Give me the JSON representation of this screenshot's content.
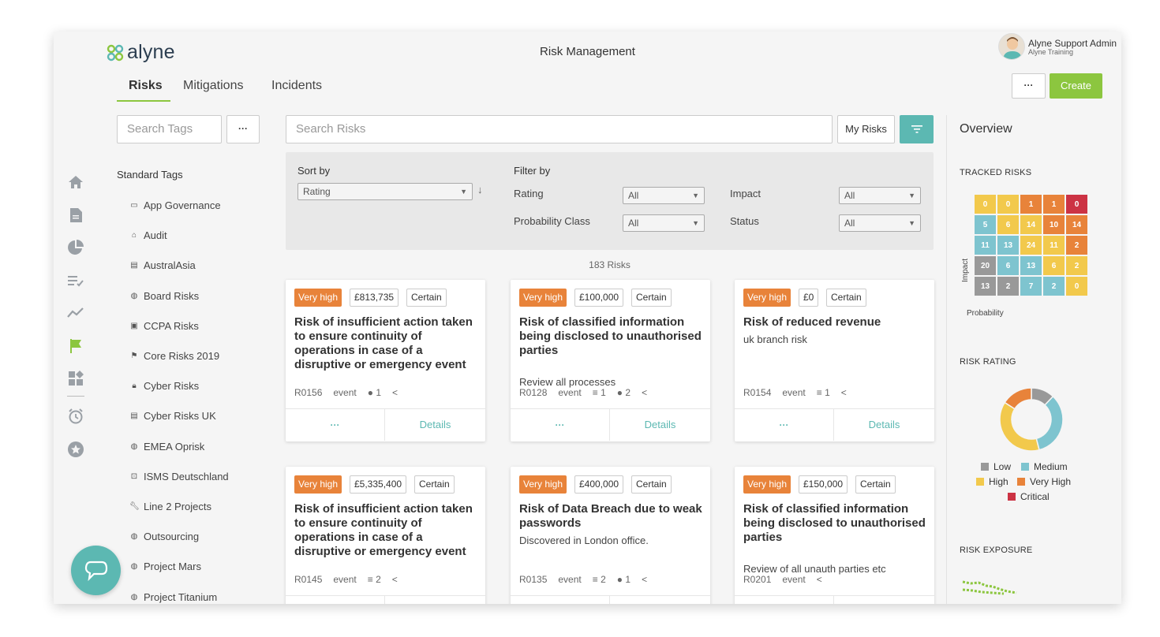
{
  "app": {
    "logo_text": "alyne",
    "page_title": "Risk Management"
  },
  "nav": {
    "tabs": [
      {
        "label": "Risks"
      },
      {
        "label": "Mitigations"
      },
      {
        "label": "Incidents"
      }
    ]
  },
  "user": {
    "name": "Alyne Support Admin",
    "org": "Alyne Training"
  },
  "toolbar": {
    "more_label": "···",
    "create_label": "Create",
    "my_risks_label": "My Risks"
  },
  "search": {
    "tags_placeholder": "Search Tags",
    "risks_placeholder": "Search Risks",
    "tags_more_label": "···"
  },
  "tags": {
    "heading": "Standard Tags",
    "items": [
      {
        "label": "App Governance",
        "icon": "laptop-icon"
      },
      {
        "label": "Audit",
        "icon": "bank-icon"
      },
      {
        "label": "AustralAsia",
        "icon": "clipboard-icon"
      },
      {
        "label": "Board Risks",
        "icon": "globe-icon"
      },
      {
        "label": "CCPA Risks",
        "icon": "id-card-icon"
      },
      {
        "label": "Core Risks 2019",
        "icon": "flag-icon"
      },
      {
        "label": "Cyber Risks",
        "icon": "lock-icon"
      },
      {
        "label": "Cyber Risks UK",
        "icon": "clipboard-icon"
      },
      {
        "label": "EMEA Oprisk",
        "icon": "globe-icon"
      },
      {
        "label": "ISMS Deutschland",
        "icon": "stamp-icon"
      },
      {
        "label": "Line 2 Projects",
        "icon": "wrench-icon"
      },
      {
        "label": "Outsourcing",
        "icon": "globe-icon"
      },
      {
        "label": "Project Mars",
        "icon": "globe-icon"
      },
      {
        "label": "Project Titanium",
        "icon": "globe-icon"
      }
    ]
  },
  "sort": {
    "label": "Sort by",
    "value": "Rating"
  },
  "filter": {
    "label": "Filter by",
    "rating_label": "Rating",
    "rating_value": "All",
    "prob_label": "Probability Class",
    "prob_value": "All",
    "impact_label": "Impact",
    "impact_value": "All",
    "status_label": "Status",
    "status_value": "All"
  },
  "risk_count": "183 Risks",
  "cards": [
    {
      "rating": "Very high",
      "amount": "£813,735",
      "prob": "Certain",
      "title": "Risk of insufficient action taken to ensure continuity of operations in case of a disruptive or emergency event",
      "desc": "",
      "id": "R0156",
      "type": "event",
      "mitigations": "",
      "issues": "1",
      "more": "···",
      "details": "Details"
    },
    {
      "rating": "Very high",
      "amount": "£100,000",
      "prob": "Certain",
      "title": "Risk of classified information being disclosed to unauthorised parties",
      "desc": "Review all processes",
      "id": "R0128",
      "type": "event",
      "mitigations": "1",
      "issues": "2",
      "more": "···",
      "details": "Details"
    },
    {
      "rating": "Very high",
      "amount": "£0",
      "prob": "Certain",
      "title": "Risk of reduced revenue",
      "desc": "uk branch risk",
      "id": "R0154",
      "type": "event",
      "mitigations": "1",
      "issues": "",
      "more": "···",
      "details": "Details"
    },
    {
      "rating": "Very high",
      "amount": "£5,335,400",
      "prob": "Certain",
      "title": "Risk of insufficient action taken to ensure continuity of operations in case of a disruptive or emergency event",
      "desc": "",
      "id": "R0145",
      "type": "event",
      "mitigations": "2",
      "issues": "",
      "more": "···",
      "details": "Details"
    },
    {
      "rating": "Very high",
      "amount": "£400,000",
      "prob": "Certain",
      "title": "Risk of Data Breach due to weak passwords",
      "desc": "Discovered in London office.",
      "id": "R0135",
      "type": "event",
      "mitigations": "2",
      "issues": "1",
      "more": "···",
      "details": "Details"
    },
    {
      "rating": "Very high",
      "amount": "£150,000",
      "prob": "Certain",
      "title": "Risk of classified information being disclosed to unauthorised parties",
      "desc": "Review of all unauth parties etc",
      "id": "R0201",
      "type": "event",
      "mitigations": "",
      "issues": "",
      "more": "···",
      "details": "Details"
    }
  ],
  "overview": {
    "title": "Overview",
    "tracked_title": "TRACKED RISKS",
    "impact_label": "Impact",
    "probability_label": "Probability",
    "heatmap": [
      [
        "0",
        "0",
        "1",
        "1",
        "0"
      ],
      [
        "5",
        "6",
        "14",
        "10",
        "14"
      ],
      [
        "11",
        "13",
        "24",
        "11",
        "2"
      ],
      [
        "20",
        "6",
        "13",
        "6",
        "2"
      ],
      [
        "13",
        "2",
        "7",
        "2",
        "0"
      ]
    ],
    "heatmap_colors": [
      [
        "#f2c94c",
        "#f2c94c",
        "#e8833a",
        "#e8833a",
        "#cc3344"
      ],
      [
        "#7ec4cf",
        "#f2c94c",
        "#f2c94c",
        "#e8833a",
        "#e8833a"
      ],
      [
        "#7ec4cf",
        "#7ec4cf",
        "#f2c94c",
        "#f2c94c",
        "#e8833a"
      ],
      [
        "#999999",
        "#7ec4cf",
        "#7ec4cf",
        "#f2c94c",
        "#f2c94c"
      ],
      [
        "#999999",
        "#999999",
        "#7ec4cf",
        "#7ec4cf",
        "#f2c94c"
      ]
    ],
    "rating_title": "RISK RATING",
    "rating_legend": [
      {
        "label": "Low",
        "color": "#999999"
      },
      {
        "label": "Medium",
        "color": "#7ec4cf"
      },
      {
        "label": "High",
        "color": "#f2c94c"
      },
      {
        "label": "Very High",
        "color": "#e8833a"
      },
      {
        "label": "Critical",
        "color": "#cc3344"
      }
    ],
    "rating_shares": [
      0.12,
      0.34,
      0.38,
      0.16,
      0.0
    ],
    "exposure_title": "RISK EXPOSURE"
  },
  "colors": {
    "accent": "#8cc63f",
    "teal": "#5cb8b2",
    "rating_badge": "#e8833a"
  }
}
